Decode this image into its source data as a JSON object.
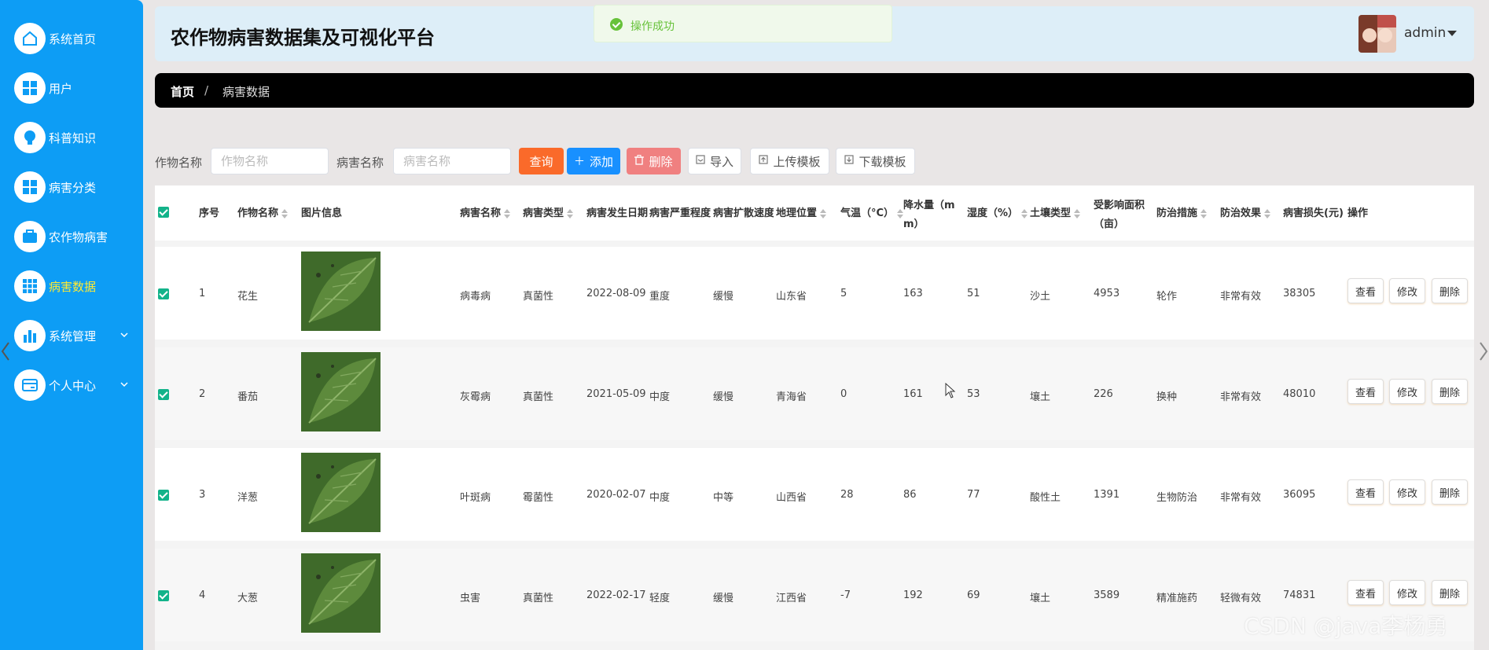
{
  "sidebar": {
    "items": [
      {
        "label": "系统首页"
      },
      {
        "label": "用户"
      },
      {
        "label": "科普知识"
      },
      {
        "label": "病害分类"
      },
      {
        "label": "农作物病害"
      },
      {
        "label": "病害数据"
      },
      {
        "label": "系统管理"
      },
      {
        "label": "个人中心"
      }
    ]
  },
  "header": {
    "title": "农作物病害数据集及可视化平台",
    "username": "admin"
  },
  "toast": {
    "message": "操作成功"
  },
  "breadcrumb": {
    "home": "首页",
    "separator": "/",
    "current": "病害数据"
  },
  "search": {
    "crop_label": "作物名称",
    "crop_placeholder": "作物名称",
    "disease_label": "病害名称",
    "disease_placeholder": "病害名称",
    "query_label": "查询",
    "add_label": "添加",
    "delete_label": "删除",
    "import_label": "导入",
    "upload_template_label": "上传模板",
    "download_template_label": "下载模板"
  },
  "table": {
    "headers": {
      "index": "序号",
      "crop": "作物名称",
      "image": "图片信息",
      "disease": "病害名称",
      "type": "病害类型",
      "date": "病害发生日期",
      "severity": "病害严重程度",
      "spread": "病害扩散速度",
      "location": "地理位置",
      "temp": "气温（°C）",
      "rain_1": "降水量（m",
      "rain_2": "m）",
      "humidity": "湿度（%）",
      "soil": "土壤类型",
      "area_1": "受影响面积",
      "area_2": "（亩）",
      "measure": "防治措施",
      "effect": "防治效果",
      "loss": "病害损失(元)",
      "ops": "操作"
    },
    "rows": [
      {
        "index": "1",
        "crop": "花生",
        "disease": "病毒病",
        "type": "真菌性",
        "date": "2022-08-09",
        "severity": "重度",
        "spread": "缓慢",
        "location": "山东省",
        "temp": "5",
        "rain": "163",
        "humidity": "51",
        "soil": "沙土",
        "area": "4953",
        "measure": "轮作",
        "effect": "非常有效",
        "loss": "38305"
      },
      {
        "index": "2",
        "crop": "番茄",
        "disease": "灰霉病",
        "type": "真菌性",
        "date": "2021-05-09",
        "severity": "中度",
        "spread": "缓慢",
        "location": "青海省",
        "temp": "0",
        "rain": "161",
        "humidity": "53",
        "soil": "壤土",
        "area": "226",
        "measure": "换种",
        "effect": "非常有效",
        "loss": "48010"
      },
      {
        "index": "3",
        "crop": "洋葱",
        "disease": "叶斑病",
        "type": "霉菌性",
        "date": "2020-02-07",
        "severity": "中度",
        "spread": "中等",
        "location": "山西省",
        "temp": "28",
        "rain": "86",
        "humidity": "77",
        "soil": "酸性土",
        "area": "1391",
        "measure": "生物防治",
        "effect": "非常有效",
        "loss": "36095"
      },
      {
        "index": "4",
        "crop": "大葱",
        "disease": "虫害",
        "type": "真菌性",
        "date": "2022-02-17",
        "severity": "轻度",
        "spread": "缓慢",
        "location": "江西省",
        "temp": "-7",
        "rain": "192",
        "humidity": "69",
        "soil": "壤土",
        "area": "3589",
        "measure": "精准施药",
        "effect": "轻微有效",
        "loss": "74831"
      }
    ],
    "actions": {
      "view": "查看",
      "edit": "修改",
      "delete": "删除"
    }
  },
  "watermark": "CSDN @java李杨勇",
  "colors": {
    "sidebar": "#0d9df5",
    "active_menu_text": "#ffea33",
    "query_button": "#fa6a2a",
    "add_button": "#1890ff",
    "delete_button": "#f08080",
    "checkbox": "#13b38a"
  }
}
